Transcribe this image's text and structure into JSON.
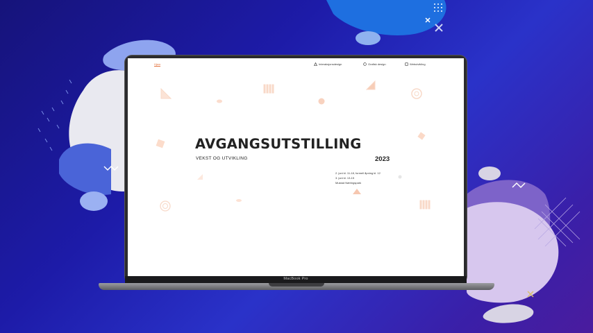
{
  "device": {
    "label": "MacBook Pro"
  },
  "nav": {
    "home": "Hjem",
    "items": [
      {
        "label": "Interaksjonsdesign",
        "icon": "triangle-icon"
      },
      {
        "label": "Grafisk design",
        "icon": "circle-icon"
      },
      {
        "label": "Webutvikling",
        "icon": "square-icon"
      }
    ]
  },
  "hero": {
    "title": "AVGANGSUTSTILLING",
    "subtitle": "VEKST OG UTVIKLING",
    "year": "2023",
    "info": [
      "2. juni kl. 11-18, formell åpning kl. 12",
      "3. juni kl. 13-15",
      "Mustad Næringspark"
    ]
  },
  "colors": {
    "accent": "#e2703a",
    "background_start": "#16137a",
    "background_end": "#4a1c9e",
    "blob_lavender": "#d7c7ee",
    "blob_light": "#e9e9f0"
  }
}
